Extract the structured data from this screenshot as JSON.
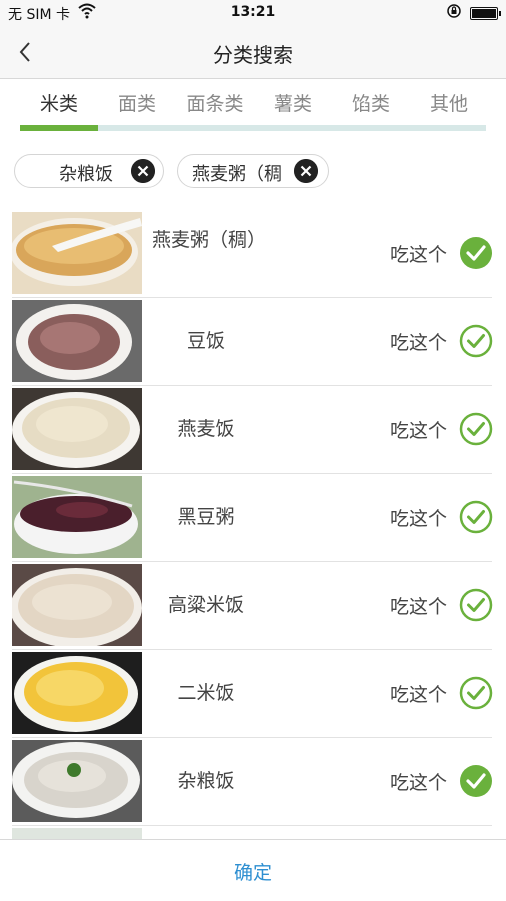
{
  "status_bar": {
    "carrier": "无 SIM 卡",
    "time": "13:21"
  },
  "nav": {
    "title": "分类搜索"
  },
  "tabs": [
    {
      "label": "米类",
      "active": true
    },
    {
      "label": "面类",
      "active": false
    },
    {
      "label": "面条类",
      "active": false
    },
    {
      "label": "薯类",
      "active": false
    },
    {
      "label": "馅类",
      "active": false
    },
    {
      "label": "其他",
      "active": false
    }
  ],
  "selected_chips": [
    {
      "label": "杂粮饭"
    },
    {
      "label": "燕麦粥（稠"
    }
  ],
  "foods": [
    {
      "name": "燕麦粥（稠）",
      "action": "吃这个",
      "selected": true
    },
    {
      "name": "豆饭",
      "action": "吃这个",
      "selected": false
    },
    {
      "name": "燕麦饭",
      "action": "吃这个",
      "selected": false
    },
    {
      "name": "黑豆粥",
      "action": "吃这个",
      "selected": false
    },
    {
      "name": "高粱米饭",
      "action": "吃这个",
      "selected": false
    },
    {
      "name": "二米饭",
      "action": "吃这个",
      "selected": false
    },
    {
      "name": "杂粮饭",
      "action": "吃这个",
      "selected": true
    }
  ],
  "footer": {
    "confirm_label": "确定"
  },
  "colors": {
    "accent_green": "#6ab13c",
    "confirm_blue": "#2e8fd1",
    "tab_track": "#d7e8e7"
  }
}
